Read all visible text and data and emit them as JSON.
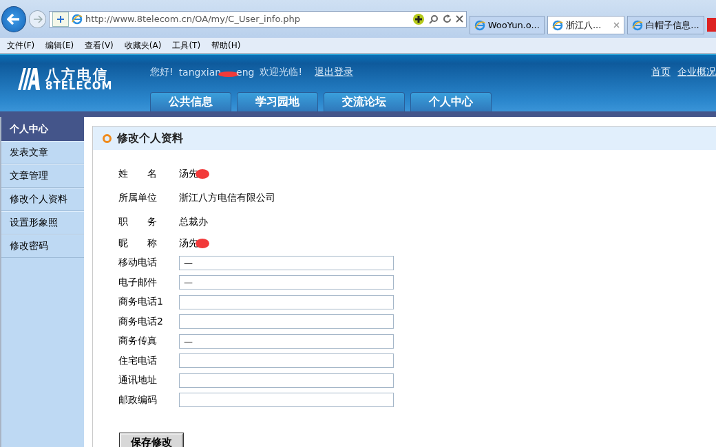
{
  "browser": {
    "address": "http://www.8telecom.cn/OA/my/C_User_info.php",
    "tabs": [
      {
        "label": "WooYun.o...",
        "selected": false
      },
      {
        "label": "浙江八...",
        "selected": true
      },
      {
        "label": "白帽子信息...",
        "selected": false
      }
    ],
    "menu": [
      "文件(F)",
      "编辑(E)",
      "查看(V)",
      "收藏夹(A)",
      "工具(T)",
      "帮助(H)"
    ]
  },
  "site": {
    "logo_cn": "八方电信",
    "logo_en": "8TELECOM",
    "greeting": "您好!",
    "user_parts": [
      "tangxian",
      "eng"
    ],
    "welcome": "欢迎光临!",
    "logout": "退出登录",
    "links": [
      "首页",
      "企业概况"
    ],
    "nav": [
      "公共信息",
      "学习园地",
      "交流论坛",
      "个人中心"
    ]
  },
  "sidebar": {
    "title": "个人中心",
    "items": [
      "发表文章",
      "文章管理",
      "修改个人资料",
      "设置形象照",
      "修改密码"
    ]
  },
  "panel": {
    "title": "修改个人资料",
    "info": [
      {
        "label": "姓　　名",
        "value": "汤先",
        "redacted": true
      },
      {
        "label": "所属单位",
        "value": "浙江八方电信有限公司",
        "redacted": false
      },
      {
        "label": "职　　务",
        "value": "总裁办",
        "redacted": false
      },
      {
        "label": "昵　　称",
        "value": "汤先",
        "redacted": true
      }
    ],
    "fields": [
      {
        "label": "移动电话",
        "value": "—"
      },
      {
        "label": "电子邮件",
        "value": "—"
      },
      {
        "label": "商务电话1"
      },
      {
        "label": "商务电话2"
      },
      {
        "label": "商务传真",
        "value": "—"
      },
      {
        "label": "住宅电话"
      },
      {
        "label": "通讯地址"
      },
      {
        "label": "邮政编码"
      }
    ],
    "save": "保存修改"
  }
}
